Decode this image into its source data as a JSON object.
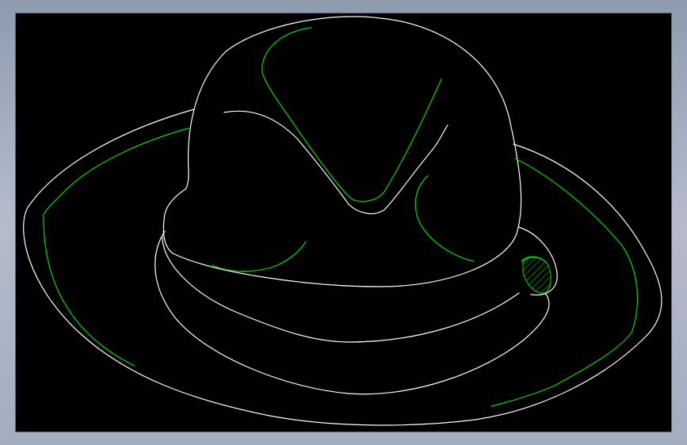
{
  "drawing": {
    "colors": {
      "background": "#000000",
      "outline": "#ffffff",
      "detail": "#00dd00",
      "frame": "#a3adbf"
    },
    "layers": {
      "outline": "hat-outline",
      "detail": "hat-detail",
      "hatch": "hatch-pattern"
    }
  }
}
